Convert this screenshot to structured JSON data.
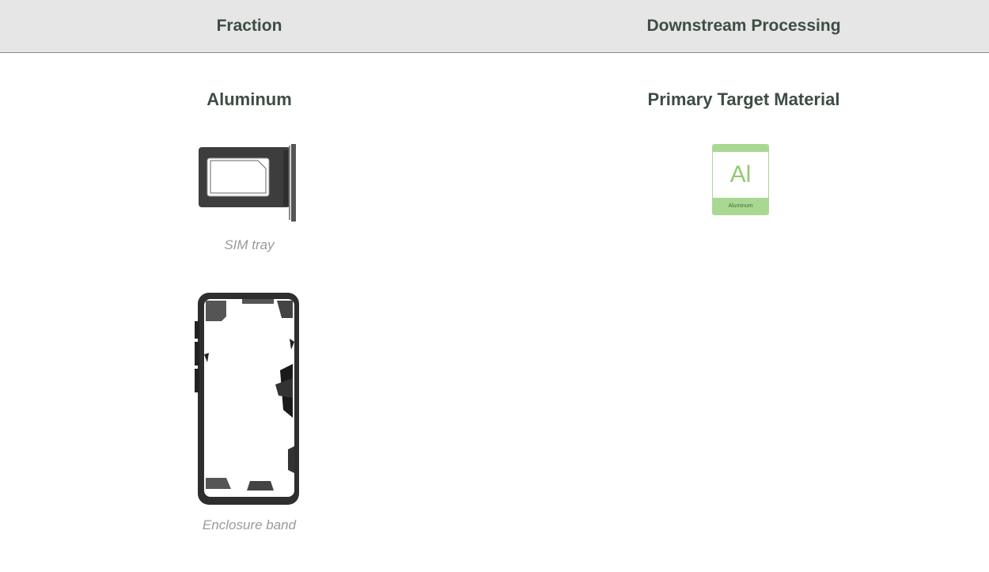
{
  "table": {
    "headers": {
      "fraction": "Fraction",
      "downstream": "Downstream Processing"
    },
    "row": {
      "fraction_title": "Aluminum",
      "downstream_title": "Primary Target Material",
      "items": [
        {
          "caption": "SIM tray",
          "icon": "sim-tray-image"
        },
        {
          "caption": "Enclosure band",
          "icon": "enclosure-band-image"
        }
      ],
      "material": {
        "symbol": "Al",
        "name": "Aluminum",
        "color": "#a8d892"
      }
    }
  }
}
